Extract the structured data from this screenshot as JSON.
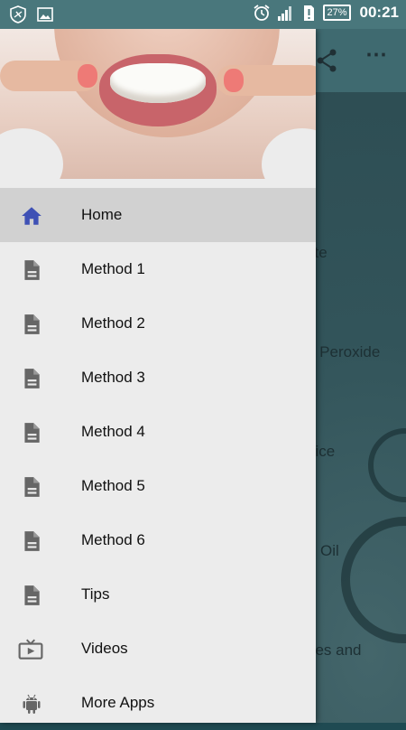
{
  "status_bar": {
    "battery": "27%",
    "time": "00:21"
  },
  "background": {
    "visible_fragments": [
      "ste",
      "n Peroxide",
      "uice",
      "Oil",
      "ries and"
    ]
  },
  "drawer": {
    "menu": [
      {
        "label": "Home",
        "icon": "home-icon",
        "active": true
      },
      {
        "label": "Method 1",
        "icon": "document-icon",
        "active": false
      },
      {
        "label": "Method 2",
        "icon": "document-icon",
        "active": false
      },
      {
        "label": "Method 3",
        "icon": "document-icon",
        "active": false
      },
      {
        "label": "Method 4",
        "icon": "document-icon",
        "active": false
      },
      {
        "label": "Method 5",
        "icon": "document-icon",
        "active": false
      },
      {
        "label": "Method 6",
        "icon": "document-icon",
        "active": false
      },
      {
        "label": "Tips",
        "icon": "document-icon",
        "active": false
      },
      {
        "label": "Videos",
        "icon": "tv-icon",
        "active": false
      },
      {
        "label": "More Apps",
        "icon": "android-icon",
        "active": false
      }
    ]
  },
  "colors": {
    "status_bar": "#49777c",
    "active_icon": "#3f51b5",
    "icon_gray": "#666666",
    "active_row": "#d1d1d1"
  }
}
